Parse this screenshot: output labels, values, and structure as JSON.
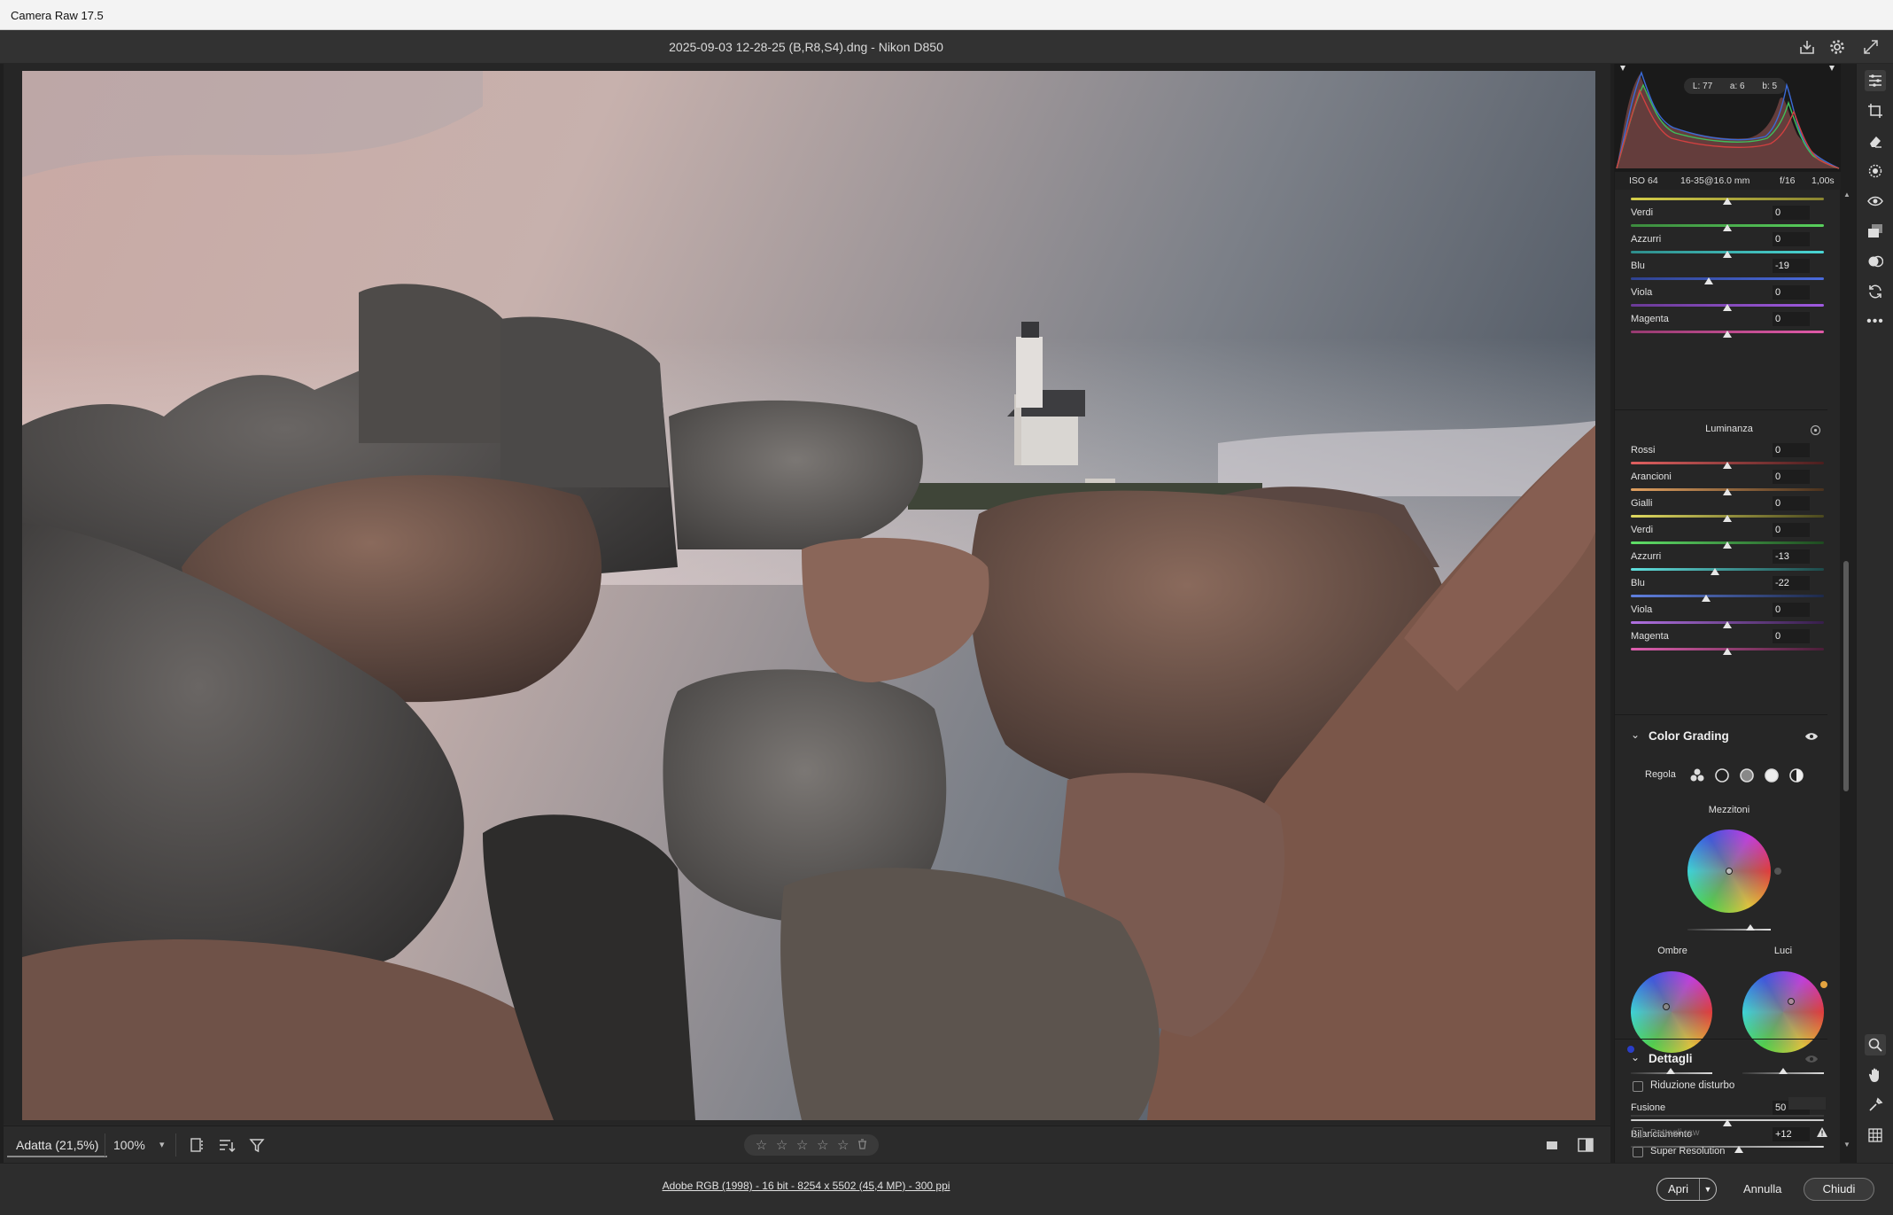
{
  "app": {
    "window_title": "Camera Raw 17.5",
    "file_title": "2025-09-03 12-28-25 (B,R8,S4).dng  -  Nikon D850"
  },
  "histogram": {
    "lab": {
      "l": "L: 77",
      "a": "a: 6",
      "b": "b: 5"
    }
  },
  "exif": {
    "iso": "ISO 64",
    "lens": "16-35@16.0 mm",
    "aperture": "f/16",
    "shutter": "1,00s"
  },
  "saturation_tail": [
    {
      "label": "Verdi",
      "value": "0",
      "pos": 0.5,
      "colors": [
        "#58d05c",
        "#3c8a3e"
      ]
    },
    {
      "label": "Azzurri",
      "value": "0",
      "pos": 0.5,
      "colors": [
        "#4ad6d4",
        "#2e8d8b"
      ]
    },
    {
      "label": "Blu",
      "value": "-19",
      "pos": 0.405,
      "colors": [
        "#4a6bdc",
        "#2f4290"
      ]
    },
    {
      "label": "Viola",
      "value": "0",
      "pos": 0.5,
      "colors": [
        "#a05ae0",
        "#6a3a96"
      ]
    },
    {
      "label": "Magenta",
      "value": "0",
      "pos": 0.5,
      "colors": [
        "#e05aa8",
        "#963a70"
      ]
    }
  ],
  "luminance": {
    "heading": "Luminanza",
    "rows": [
      {
        "label": "Rossi",
        "value": "0",
        "pos": 0.5,
        "colors": [
          "#4a1e1e",
          "#e06060"
        ]
      },
      {
        "label": "Arancioni",
        "value": "0",
        "pos": 0.5,
        "colors": [
          "#4a321e",
          "#e0a060"
        ]
      },
      {
        "label": "Gialli",
        "value": "0",
        "pos": 0.5,
        "colors": [
          "#4a481e",
          "#e0da60"
        ]
      },
      {
        "label": "Verdi",
        "value": "0",
        "pos": 0.5,
        "colors": [
          "#1e4a20",
          "#60e068"
        ]
      },
      {
        "label": "Azzurri",
        "value": "-13",
        "pos": 0.435,
        "colors": [
          "#1e4a4a",
          "#60e0de"
        ]
      },
      {
        "label": "Blu",
        "value": "-22",
        "pos": 0.39,
        "colors": [
          "#1e2a4a",
          "#6080e0"
        ]
      },
      {
        "label": "Viola",
        "value": "0",
        "pos": 0.5,
        "colors": [
          "#361e4a",
          "#b070e0"
        ]
      },
      {
        "label": "Magenta",
        "value": "0",
        "pos": 0.5,
        "colors": [
          "#4a1e38",
          "#e060b0"
        ]
      }
    ]
  },
  "color_grading": {
    "title": "Color Grading",
    "adjust_label": "Regola",
    "midtones_label": "Mezzitoni",
    "shadows_label": "Ombre",
    "highlights_label": "Luci",
    "blending": {
      "label": "Fusione",
      "value": "50",
      "pos": 0.5
    },
    "balance": {
      "label": "Bilanciamento",
      "value": "+12",
      "pos": 0.56
    }
  },
  "details": {
    "title": "Dettagli",
    "noise_reduction": "Riduzione disturbo",
    "raw_details": "Dettagli raw",
    "super_resolution": "Super Resolution"
  },
  "bottombar": {
    "fit_label": "Adatta (21,5%)",
    "zoom_label": "100%",
    "stars": [
      "☆",
      "☆",
      "☆",
      "☆",
      "☆"
    ]
  },
  "footer": {
    "workflow": "Adobe RGB (1998) - 16 bit - 8254 x 5502 (45,4 MP) - 300 ppi",
    "open": "Apri",
    "cancel": "Annulla",
    "close": "Chiudi"
  }
}
